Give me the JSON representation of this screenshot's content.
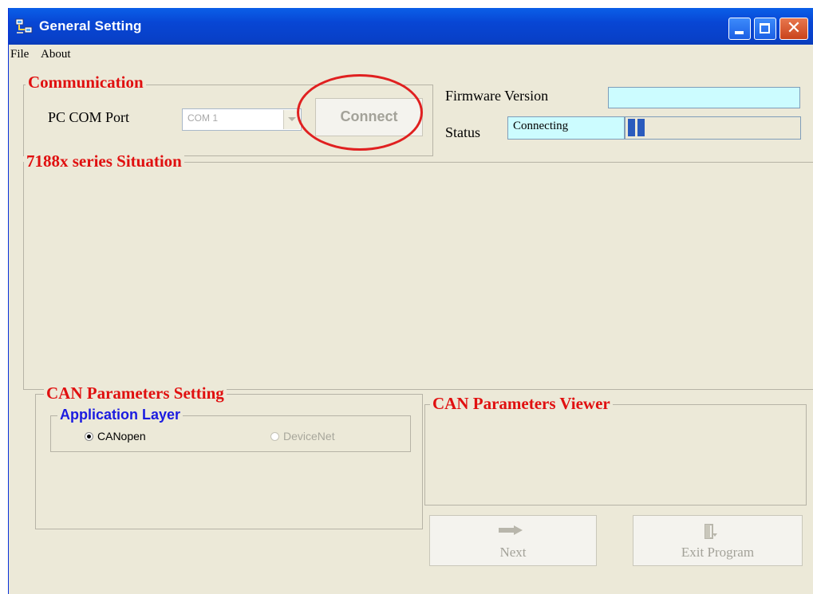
{
  "window": {
    "title": "General Setting",
    "icons": {
      "app": "network-computer-icon",
      "minimize": "minimize-icon",
      "maximize": "maximize-icon",
      "close": "close-icon"
    }
  },
  "menu": {
    "items": [
      "File",
      "About"
    ]
  },
  "communication": {
    "legend": "Communication",
    "port_label": "PC COM Port",
    "port_value": "COM 1",
    "connect_label": "Connect"
  },
  "firmware": {
    "label": "Firmware Version",
    "value": ""
  },
  "status": {
    "label": "Status",
    "value": "Connecting",
    "progress_segments": 2
  },
  "situation": {
    "legend": "7188x series Situation"
  },
  "can_setting": {
    "legend": "CAN Parameters Setting",
    "app_layer": {
      "legend": "Application Layer",
      "options": [
        {
          "label": "CANopen",
          "selected": true,
          "enabled": true
        },
        {
          "label": "DeviceNet",
          "selected": false,
          "enabled": false
        }
      ]
    }
  },
  "can_viewer": {
    "legend": "CAN Parameters Viewer"
  },
  "buttons": {
    "next_label": "Next",
    "exit_label": "Exit Program",
    "next_icon": "right-arrow-icon",
    "exit_icon": "exit-door-icon"
  },
  "colors": {
    "title_bar": "#0a52df",
    "legend_red": "#e01010",
    "legend_blue": "#1b1be0",
    "textbox_bg": "#ccfcff",
    "progress_blue": "#2a5bbd",
    "annotation": "#e02020"
  }
}
